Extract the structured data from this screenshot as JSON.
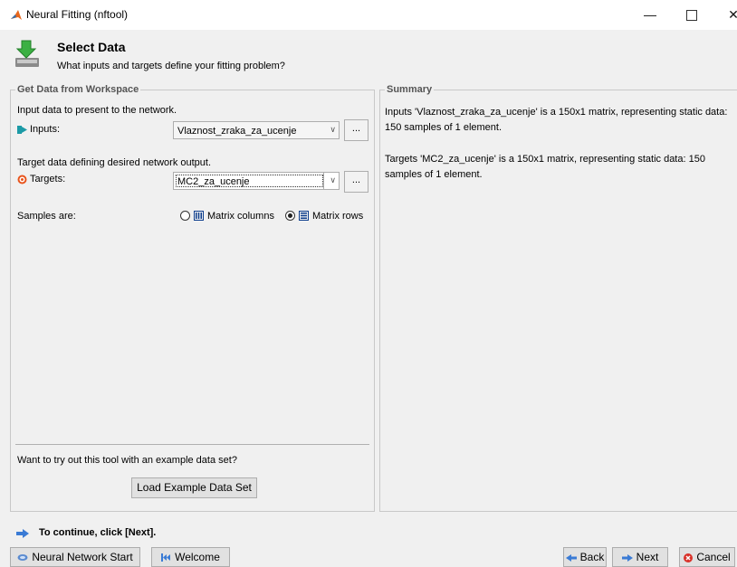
{
  "window": {
    "title": "Neural Fitting (nftool)",
    "min_glyph": "—",
    "close_glyph": "✕",
    "app_icon": "matlab-icon"
  },
  "header": {
    "icon": "download-arrow-icon",
    "title": "Select Data",
    "subtitle": "What inputs and targets define your fitting problem?"
  },
  "workspace_panel": {
    "legend": "Get Data from Workspace",
    "input_intro": "Input data to present to the network.",
    "inputs_label": "Inputs:",
    "inputs_value": "Vlaznost_zraka_za_ucenje",
    "target_intro": "Target data defining desired network output.",
    "targets_label": "Targets:",
    "targets_value": "MC2_za_ucenje",
    "browse_label": "...",
    "samples_label": "Samples are:",
    "option_columns": "Matrix columns",
    "option_rows": "Matrix rows",
    "selected_option": "Matrix rows",
    "example_prompt": "Want to try out this tool with an example data set?",
    "load_example_label": "Load Example Data Set"
  },
  "summary_panel": {
    "legend": "Summary",
    "inputs_summary": "Inputs 'Vlaznost_zraka_za_ucenje' is a 150x1 matrix, representing static data: 150 samples of 1 element.",
    "targets_summary": "Targets 'MC2_za_ucenje' is a 150x1 matrix, representing static data: 150 samples of 1 element."
  },
  "footer": {
    "continue_text": "To continue, click [Next].",
    "nn_start_label": "Neural Network Start",
    "welcome_label": "Welcome",
    "back_label": "Back",
    "next_label": "Next",
    "cancel_label": "Cancel"
  },
  "colors": {
    "accent_blue": "#3a7bd5",
    "cancel_red": "#d9322a",
    "target_orange": "#e8541c",
    "input_teal": "#1c9aa6"
  }
}
